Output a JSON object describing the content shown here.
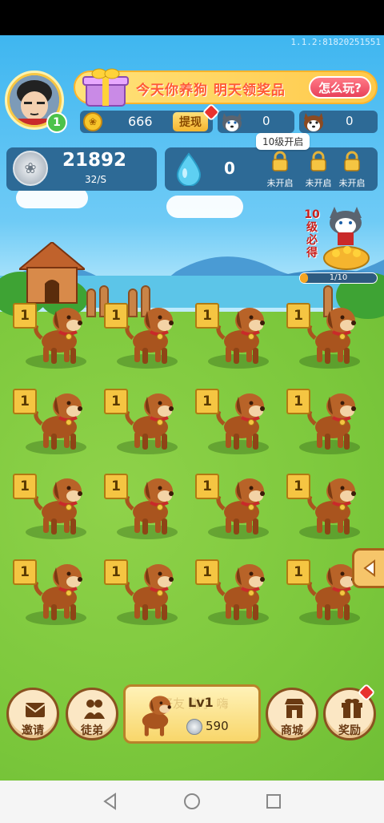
{
  "app": {
    "version": "1.1.2:81820251551"
  },
  "header": {
    "level": "1",
    "banner_text": "今天你养狗 明天领奖品",
    "howto_label": "怎么玩?",
    "coins_value": "666",
    "withdraw_label": "提现",
    "husky_counts": [
      "0",
      "0"
    ]
  },
  "resources": {
    "silver_value": "21892",
    "silver_rate": "32/S",
    "gem_value": "0",
    "tooltip": "10级开启",
    "locked_slots": [
      {
        "label": "未开启"
      },
      {
        "label": "未开启"
      },
      {
        "label": "未开启"
      }
    ]
  },
  "promo": {
    "vertical_text": "10级必得",
    "progress_text": "1/10",
    "progress_fraction": 0.1
  },
  "grid": {
    "dog_level": "1",
    "rows": 4,
    "cols": 4
  },
  "bottom": {
    "invite_label": "邀请",
    "apprentice_label": "徒弟",
    "buy_level": "Lv1",
    "buy_price": "590",
    "buy_watermark": "好友 赚了 嗨",
    "shop_label": "商城",
    "reward_label": "奖励"
  },
  "colors": {
    "panel": "#2d6a96",
    "gold": "#f5c542",
    "grass": "#7cc83c",
    "sky": "#3fb6f0"
  }
}
